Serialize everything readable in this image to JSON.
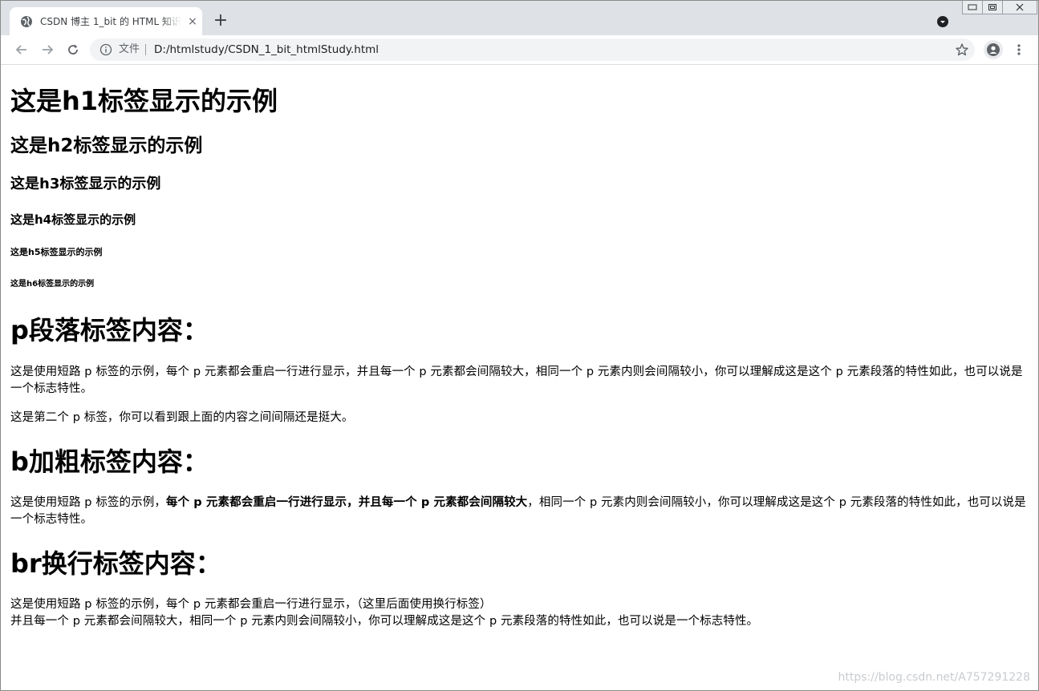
{
  "browser": {
    "tab_title": "CSDN 博主 1_bit 的 HTML 知识",
    "tab_close": "×",
    "new_tab": "+",
    "security_chip": "文件",
    "url": "D:/htmlstudy/CSDN_1_bit_htmlStudy.html"
  },
  "page": {
    "headings": {
      "h1": "这是h1标签显示的示例",
      "h2": "这是h2标签显示的示例",
      "h3": "这是h3标签显示的示例",
      "h4": "这是h4标签显示的示例",
      "h5": "这是h5标签显示的示例",
      "h6": "这是h6标签显示的示例"
    },
    "p_section": {
      "title": "p段落标签内容：",
      "para1": "这是使用短路 p 标签的示例，每个 p 元素都会重启一行进行显示，并且每一个 p 元素都会间隔较大，相同一个 p 元素内则会间隔较小，你可以理解成这是这个 p 元素段落的特性如此，也可以说是一个标志特性。",
      "para2": "这是第二个 p 标签，你可以看到跟上面的内容之间间隔还是挺大。"
    },
    "b_section": {
      "title": "b加粗标签内容：",
      "before": "这是使用短路 p 标签的示例，",
      "bold": "每个 p 元素都会重启一行进行显示，并且每一个 p 元素都会间隔较大",
      "after": "，相同一个 p 元素内则会间隔较小，你可以理解成这是这个 p 元素段落的特性如此，也可以说是一个标志特性。"
    },
    "br_section": {
      "title": "br换行标签内容：",
      "line1": "这是使用短路 p 标签的示例，每个 p 元素都会重启一行进行显示，（这里后面使用换行标签）",
      "line2": "并且每一个 p 元素都会间隔较大，相同一个 p 元素内则会间隔较小，你可以理解成这是这个 p 元素段落的特性如此，也可以说是一个标志特性。"
    },
    "watermark": "https://blog.csdn.net/A757291228"
  },
  "icons": {
    "favicon": "globe-icon",
    "back": "back-arrow-icon",
    "forward": "forward-arrow-icon",
    "reload": "reload-icon",
    "info": "info-icon",
    "bookmark": "star-icon",
    "profile": "person-icon",
    "menu": "three-dots-icon",
    "tab_search": "tab-search-icon",
    "minimize": "minimize-icon",
    "restore": "restore-icon",
    "close": "window-close-icon"
  },
  "colors": {
    "tabstrip": "#dee1e6",
    "omnibox": "#f1f3f4",
    "text": "#000000",
    "watermark": "#c9ccd0"
  }
}
